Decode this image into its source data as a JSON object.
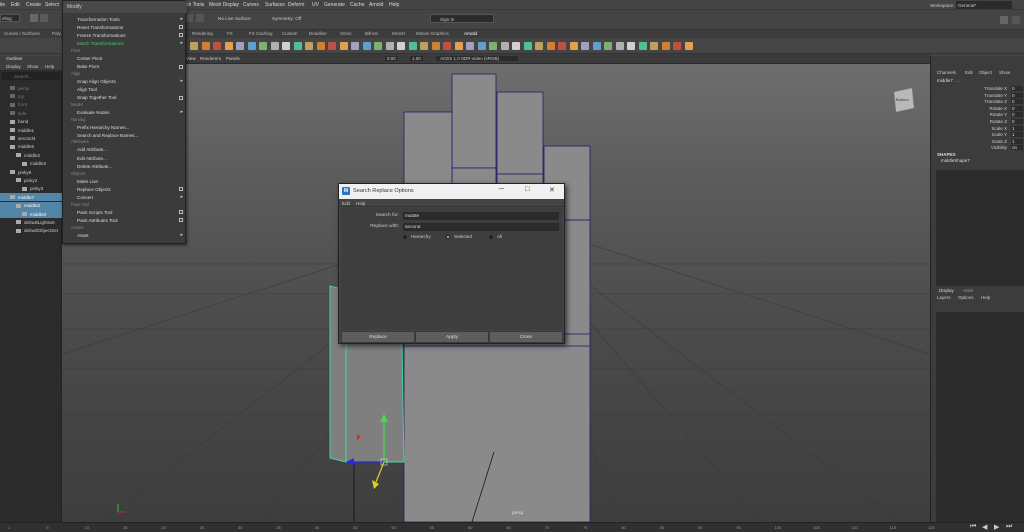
{
  "menubar": {
    "items": [
      "ile",
      "Edit",
      "Create",
      "Select",
      "Modify",
      "sh Tools",
      "Mesh Display",
      "Curves",
      "Surfaces",
      "Deform",
      "UV",
      "Generate",
      "Cache",
      "Arnold",
      "Help"
    ],
    "workspace_label": "Workspace:",
    "workspace_value": "General*"
  },
  "statusline": {
    "mode_value": "eling",
    "live_surface": "No Live Surface",
    "symmetry": "Symmetry: Off",
    "sign_in": "Sign In"
  },
  "shelf": {
    "tabs": [
      "Curves / Surfaces",
      "Poly",
      "Rendering",
      "FX",
      "FX Caching",
      "Custom",
      "Deadline",
      "XGen",
      "Bifrost",
      "MASH",
      "Motion Graphics",
      "Arnold"
    ]
  },
  "outliner": {
    "title": "Outliner",
    "menus": [
      "Display",
      "Show",
      "Help"
    ],
    "search_placeholder": "Search...",
    "items": [
      {
        "label": "persp",
        "dim": true,
        "indent": 18
      },
      {
        "label": "top",
        "dim": true,
        "indent": 18
      },
      {
        "label": "front",
        "dim": true,
        "indent": 18
      },
      {
        "label": "side",
        "dim": true,
        "indent": 18
      },
      {
        "label": "hand",
        "dim": false,
        "indent": 18
      },
      {
        "label": "middle1",
        "dim": false,
        "indent": 18
      },
      {
        "label": "second4",
        "dim": false,
        "indent": 18
      },
      {
        "label": "middle5",
        "dim": false,
        "indent": 18
      },
      {
        "label": "middle2",
        "dim": false,
        "indent": 24
      },
      {
        "label": "middle3",
        "dim": false,
        "indent": 30
      },
      {
        "label": "pinky6",
        "dim": false,
        "indent": 18
      },
      {
        "label": "pinky2",
        "dim": false,
        "indent": 24
      },
      {
        "label": "pinky3",
        "dim": false,
        "indent": 30
      },
      {
        "label": "middle7",
        "dim": false,
        "indent": 18,
        "selected": true
      },
      {
        "label": "middle2",
        "dim": false,
        "indent": 24,
        "selected": true
      },
      {
        "label": "middle3",
        "dim": false,
        "indent": 30,
        "selected": true
      },
      {
        "label": "defaultLightSet",
        "dim": false,
        "indent": 24
      },
      {
        "label": "defaultObjectSet",
        "dim": false,
        "indent": 24
      }
    ]
  },
  "modify_menu": {
    "title": "Modify",
    "entries": [
      {
        "kind": "item",
        "label": "Transformation Tools",
        "suffix": "arrow"
      },
      {
        "kind": "item",
        "label": "Reset Transformations",
        "suffix": "box"
      },
      {
        "kind": "item",
        "label": "Freeze Transformations",
        "suffix": "box"
      },
      {
        "kind": "item",
        "label": "Match Transformations",
        "suffix": "arrow",
        "highlight": true
      },
      {
        "kind": "section",
        "label": "Pivot"
      },
      {
        "kind": "item",
        "label": "Center Pivot"
      },
      {
        "kind": "item",
        "label": "Bake Pivot",
        "suffix": "box"
      },
      {
        "kind": "section",
        "label": "Align"
      },
      {
        "kind": "item",
        "label": "Snap Align Objects",
        "suffix": "arrow"
      },
      {
        "kind": "item",
        "label": "Align Tool"
      },
      {
        "kind": "item",
        "label": "Snap Together Tool",
        "suffix": "box"
      },
      {
        "kind": "section",
        "label": "Nodes"
      },
      {
        "kind": "item",
        "label": "Evaluate Nodes",
        "suffix": "arrow"
      },
      {
        "kind": "section",
        "label": "Naming"
      },
      {
        "kind": "item",
        "label": "Prefix Hierarchy Names..."
      },
      {
        "kind": "item",
        "label": "Search and Replace Names..."
      },
      {
        "kind": "section",
        "label": "Attributes"
      },
      {
        "kind": "item",
        "label": "Add Attribute..."
      },
      {
        "kind": "item",
        "label": "Edit Attribute..."
      },
      {
        "kind": "item",
        "label": "Delete Attribute..."
      },
      {
        "kind": "section",
        "label": "Objects"
      },
      {
        "kind": "item",
        "label": "Make Live"
      },
      {
        "kind": "item",
        "label": "Replace Objects",
        "suffix": "box"
      },
      {
        "kind": "item",
        "label": "Convert",
        "suffix": "arrow"
      },
      {
        "kind": "section",
        "label": "Paint Tool"
      },
      {
        "kind": "item",
        "label": "Paint Scripts Tool",
        "suffix": "box"
      },
      {
        "kind": "item",
        "label": "Paint Attributes Tool",
        "suffix": "box"
      },
      {
        "kind": "section",
        "label": "Assets"
      },
      {
        "kind": "item",
        "label": "Asset",
        "suffix": "arrow"
      }
    ]
  },
  "viewport": {
    "menus": [
      "View",
      "Renderers",
      "Panels"
    ],
    "val1": "0.00",
    "val2": "1.00",
    "colorspace": "ACES 1.0 SDR-video (sRGB)",
    "view_cube": "Bottom",
    "camera_label": "persp"
  },
  "dialog": {
    "title": "Search Replace Options",
    "menus": [
      "Edit",
      "Help"
    ],
    "search_label": "Search for:",
    "search_value": "middle",
    "replace_label": "Replace with:",
    "replace_value": "second",
    "radios": [
      {
        "label": "Hierarchy",
        "on": false
      },
      {
        "label": "Selected",
        "on": true
      },
      {
        "label": "All",
        "on": false
      }
    ],
    "buttons": [
      "Replace",
      "Apply",
      "Close"
    ]
  },
  "channel_box": {
    "menus": [
      "Channels",
      "Edit",
      "Object",
      "Show"
    ],
    "object": "middle7 . . .",
    "attrs": [
      {
        "label": "Translate X",
        "value": "0"
      },
      {
        "label": "Translate Y",
        "value": "0"
      },
      {
        "label": "Translate Z",
        "value": "0"
      },
      {
        "label": "Rotate X",
        "value": "0"
      },
      {
        "label": "Rotate Y",
        "value": "0"
      },
      {
        "label": "Rotate Z",
        "value": "0"
      },
      {
        "label": "Scale X",
        "value": "1"
      },
      {
        "label": "Scale Y",
        "value": "1"
      },
      {
        "label": "Scale Z",
        "value": "1"
      },
      {
        "label": "Visibility",
        "value": "on"
      }
    ],
    "shapes_label": "SHAPES",
    "shape_name": "middleShape7",
    "layer_tabs": [
      "Display",
      "Anim"
    ],
    "layer_menus": [
      "Layers",
      "Options",
      "Help"
    ]
  },
  "timeline": {
    "ticks": [
      "1",
      "5",
      "10",
      "15",
      "20",
      "25",
      "30",
      "35",
      "40",
      "45",
      "50",
      "55",
      "60",
      "65",
      "70",
      "75",
      "80",
      "85",
      "90",
      "95",
      "100",
      "105",
      "110",
      "115",
      "120"
    ]
  },
  "colors": {
    "selection": "#5285a6",
    "highlight_text": "#3fd05c",
    "select_wire": "#3de0a0"
  }
}
